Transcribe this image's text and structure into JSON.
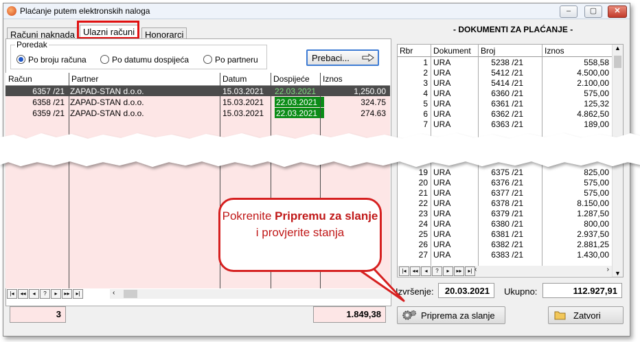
{
  "window": {
    "title": "Plaćanje putem elektronskih naloga"
  },
  "tabs": [
    {
      "label": "Računi naknada"
    },
    {
      "label": "Ulazni računi"
    },
    {
      "label": "Honorarci"
    }
  ],
  "sort_group": {
    "legend": "Poredak",
    "options": [
      "Po broju računa",
      "Po datumu dospijeća",
      "Po partneru"
    ],
    "selected_index": 0
  },
  "prebaci_label": "Prebaci...",
  "invoice_grid": {
    "headers": [
      "Račun",
      "Partner",
      "Datum",
      "Dospijeće",
      "Iznos"
    ],
    "rows": [
      {
        "racun": "6357 /21",
        "partner": "ZAPAD-STAN d.o.o.",
        "datum": "15.03.2021",
        "dospijece": "22.03.2021",
        "iznos": "1,250.00"
      },
      {
        "racun": "6358 /21",
        "partner": "ZAPAD-STAN d.o.o.",
        "datum": "15.03.2021",
        "dospijece": "22.03.2021",
        "iznos": "324.75"
      },
      {
        "racun": "6359 /21",
        "partner": "ZAPAD-STAN d.o.o.",
        "datum": "15.03.2021",
        "dospijece": "22.03.2021",
        "iznos": "274.63"
      }
    ]
  },
  "pager_glyphs": [
    "|◂",
    "◂◂",
    "◂",
    "?",
    "▸",
    "▸▸",
    "▸|"
  ],
  "left_count": "3",
  "left_total": "1.849,38",
  "docs_title": "- DOKUMENTI ZA PLAĆANJE -",
  "docs_grid": {
    "headers": [
      "Rbr",
      "Dokument",
      "Broj",
      "Iznos"
    ],
    "top_rows": [
      {
        "rbr": "1",
        "dok": "URA",
        "broj": "5238 /21",
        "iznos": "558,58"
      },
      {
        "rbr": "2",
        "dok": "URA",
        "broj": "5412 /21",
        "iznos": "4.500,00"
      },
      {
        "rbr": "3",
        "dok": "URA",
        "broj": "5414 /21",
        "iznos": "2.100,00"
      },
      {
        "rbr": "4",
        "dok": "URA",
        "broj": "6360 /21",
        "iznos": "575,00"
      },
      {
        "rbr": "5",
        "dok": "URA",
        "broj": "6361 /21",
        "iznos": "125,32"
      },
      {
        "rbr": "6",
        "dok": "URA",
        "broj": "6362 /21",
        "iznos": "4.862,50"
      },
      {
        "rbr": "7",
        "dok": "URA",
        "broj": "6363 /21",
        "iznos": "189,00"
      }
    ],
    "bottom_rows": [
      {
        "rbr": "19",
        "dok": "URA",
        "broj": "6375 /21",
        "iznos": "825,00"
      },
      {
        "rbr": "20",
        "dok": "URA",
        "broj": "6376 /21",
        "iznos": "575,00"
      },
      {
        "rbr": "21",
        "dok": "URA",
        "broj": "6377 /21",
        "iznos": "575,00"
      },
      {
        "rbr": "22",
        "dok": "URA",
        "broj": "6378 /21",
        "iznos": "8.150,00"
      },
      {
        "rbr": "23",
        "dok": "URA",
        "broj": "6379 /21",
        "iznos": "1.287,50"
      },
      {
        "rbr": "24",
        "dok": "URA",
        "broj": "6380 /21",
        "iznos": "800,00"
      },
      {
        "rbr": "25",
        "dok": "URA",
        "broj": "6381 /21",
        "iznos": "2.937,50"
      },
      {
        "rbr": "26",
        "dok": "URA",
        "broj": "6382 /21",
        "iznos": "2.881,25"
      },
      {
        "rbr": "27",
        "dok": "URA",
        "broj": "6383 /21",
        "iznos": "1.430,00"
      }
    ]
  },
  "izvrsenje": {
    "label": "Izvršenje:",
    "value": "20.03.2021"
  },
  "ukupno": {
    "label": "Ukupno:",
    "value": "112.927,91"
  },
  "buttons": {
    "priprema": "Priprema za slanje",
    "zatvori": "Zatvori"
  },
  "callout": {
    "before": "Pokrenite ",
    "bold": "Pripremu za slanje",
    "after": " i provjerite stanja"
  },
  "colors": {
    "due_green": "#0b8c17",
    "row_pink": "#fde6e6",
    "highlight_red": "#e01010"
  }
}
